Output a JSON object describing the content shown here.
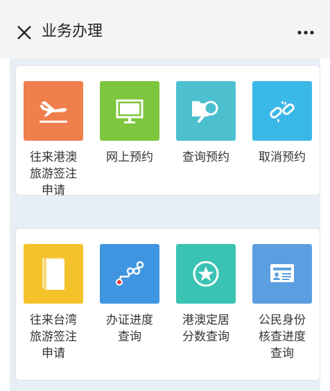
{
  "header": {
    "title": "业务办理",
    "close_icon": "close-icon",
    "more_icon": "more-dots-icon"
  },
  "sections": [
    {
      "items": [
        {
          "label": "往来港澳\n旅游签注\n申请",
          "icon": "airplane-landing-icon",
          "color": "#f07f4e"
        },
        {
          "label": "网上预约",
          "icon": "monitor-icon",
          "color": "#7dc63e"
        },
        {
          "label": "查询预约",
          "icon": "folder-search-icon",
          "color": "#4dc0d0"
        },
        {
          "label": "取消预约",
          "icon": "broken-link-icon",
          "color": "#3ab8e8"
        }
      ]
    },
    {
      "items": [
        {
          "label": "往来台湾\n旅游签注\n申请",
          "icon": "book-icon",
          "color": "#f4c22b"
        },
        {
          "label": "办证进度\n查询",
          "icon": "progress-path-icon",
          "color": "#3f95e0"
        },
        {
          "label": "港澳定居\n分数查询",
          "icon": "star-badge-icon",
          "color": "#3ac3b3"
        },
        {
          "label": "公民身份\n核查进度\n查询",
          "icon": "id-card-icon",
          "color": "#5c9fe0"
        }
      ]
    }
  ]
}
